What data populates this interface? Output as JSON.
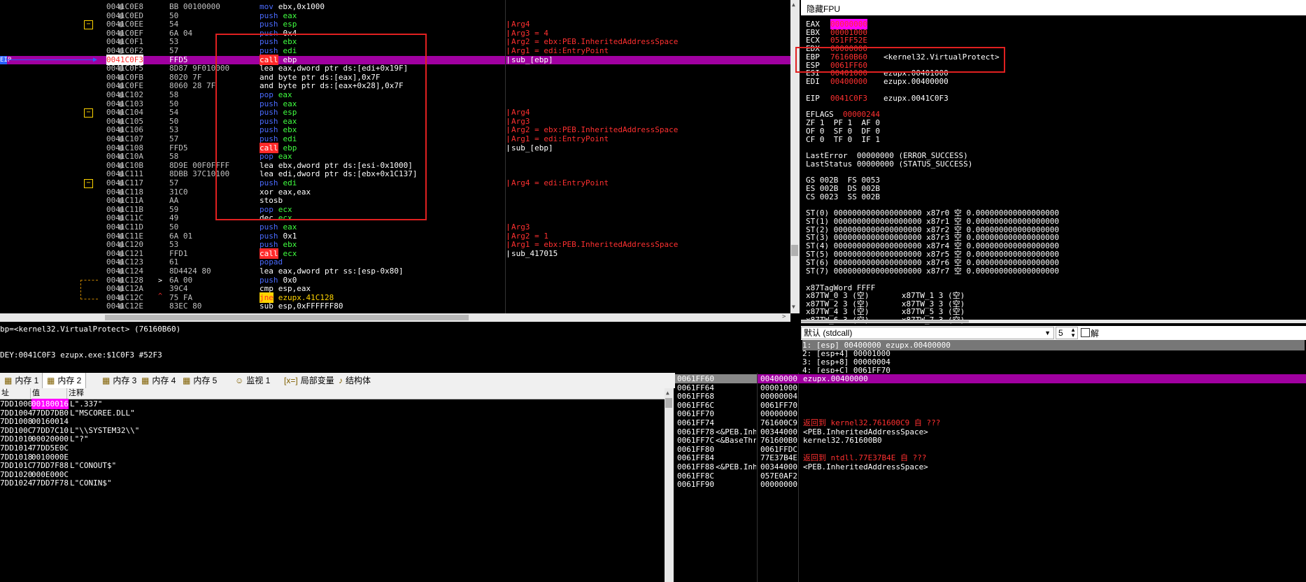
{
  "disasm": {
    "rows": [
      {
        "addr": "0041C0E8",
        "bytes": "BB 00100000",
        "mn": "mov",
        "ops": "ebx,0x1000",
        "cmt": ""
      },
      {
        "addr": "0041C0ED",
        "bytes": "50",
        "mn": "push",
        "ops": "eax",
        "cmt": ""
      },
      {
        "addr": "0041C0EE",
        "bytes": "54",
        "mn": "push",
        "ops": "esp",
        "cmt": "Arg4"
      },
      {
        "addr": "0041C0EF",
        "bytes": "6A 04",
        "mn": "push",
        "ops": "0x4",
        "cmt": "Arg3 = 4"
      },
      {
        "addr": "0041C0F1",
        "bytes": "53",
        "mn": "push",
        "ops": "ebx",
        "cmt": "Arg2 = ebx:PEB.InheritedAddressSpace"
      },
      {
        "addr": "0041C0F2",
        "bytes": "57",
        "mn": "push",
        "ops": "edi",
        "cmt": "Arg1 = edi:EntryPoint"
      },
      {
        "addr": "0041C0F3",
        "bytes": "FFD5",
        "mn": "call",
        "ops": "ebp",
        "cmt": "sub_[ebp]"
      },
      {
        "addr": "0041C0F5",
        "bytes": "8D87 9F010000",
        "mn": "lea",
        "ops": "eax,dword ptr ds:[edi+0x19F]",
        "cmt": ""
      },
      {
        "addr": "0041C0FB",
        "bytes": "8020 7F",
        "mn": "and",
        "ops": "byte ptr ds:[eax],0x7F",
        "cmt": ""
      },
      {
        "addr": "0041C0FE",
        "bytes": "8060 28 7F",
        "mn": "and",
        "ops": "byte ptr ds:[eax+0x28],0x7F",
        "cmt": ""
      },
      {
        "addr": "0041C102",
        "bytes": "58",
        "mn": "pop",
        "ops": "eax",
        "cmt": ""
      },
      {
        "addr": "0041C103",
        "bytes": "50",
        "mn": "push",
        "ops": "eax",
        "cmt": ""
      },
      {
        "addr": "0041C104",
        "bytes": "54",
        "mn": "push",
        "ops": "esp",
        "cmt": "Arg4"
      },
      {
        "addr": "0041C105",
        "bytes": "50",
        "mn": "push",
        "ops": "eax",
        "cmt": "Arg3"
      },
      {
        "addr": "0041C106",
        "bytes": "53",
        "mn": "push",
        "ops": "ebx",
        "cmt": "Arg2 = ebx:PEB.InheritedAddressSpace"
      },
      {
        "addr": "0041C107",
        "bytes": "57",
        "mn": "push",
        "ops": "edi",
        "cmt": "Arg1 = edi:EntryPoint"
      },
      {
        "addr": "0041C108",
        "bytes": "FFD5",
        "mn": "call",
        "ops": "ebp",
        "cmt": "sub_[ebp]"
      },
      {
        "addr": "0041C10A",
        "bytes": "58",
        "mn": "pop",
        "ops": "eax",
        "cmt": ""
      },
      {
        "addr": "0041C10B",
        "bytes": "8D9E 00F0FFFF",
        "mn": "lea",
        "ops": "ebx,dword ptr ds:[esi-0x1000]",
        "cmt": ""
      },
      {
        "addr": "0041C111",
        "bytes": "8DBB 37C10100",
        "mn": "lea",
        "ops": "edi,dword ptr ds:[ebx+0x1C137]",
        "cmt": ""
      },
      {
        "addr": "0041C117",
        "bytes": "57",
        "mn": "push",
        "ops": "edi",
        "cmt": "Arg4 = edi:EntryPoint"
      },
      {
        "addr": "0041C118",
        "bytes": "31C0",
        "mn": "xor",
        "ops": "eax,eax",
        "cmt": ""
      },
      {
        "addr": "0041C11A",
        "bytes": "AA",
        "mn": "stosb",
        "ops": "",
        "cmt": ""
      },
      {
        "addr": "0041C11B",
        "bytes": "59",
        "mn": "pop",
        "ops": "ecx",
        "cmt": ""
      },
      {
        "addr": "0041C11C",
        "bytes": "49",
        "mn": "dec",
        "ops": "ecx",
        "cmt": ""
      },
      {
        "addr": "0041C11D",
        "bytes": "50",
        "mn": "push",
        "ops": "eax",
        "cmt": "Arg3"
      },
      {
        "addr": "0041C11E",
        "bytes": "6A 01",
        "mn": "push",
        "ops": "0x1",
        "cmt": "Arg2 = 1"
      },
      {
        "addr": "0041C120",
        "bytes": "53",
        "mn": "push",
        "ops": "ebx",
        "cmt": "Arg1 = ebx:PEB.InheritedAddressSpace"
      },
      {
        "addr": "0041C121",
        "bytes": "FFD1",
        "mn": "call",
        "ops": "ecx",
        "cmt": "sub_417015"
      },
      {
        "addr": "0041C123",
        "bytes": "61",
        "mn": "popad",
        "ops": "",
        "cmt": ""
      },
      {
        "addr": "0041C124",
        "bytes": "8D4424 80",
        "mn": "lea",
        "ops": "eax,dword ptr ss:[esp-0x80]",
        "cmt": ""
      },
      {
        "addr": "0041C128",
        "bytes": "6A 00",
        "mn": "push",
        "ops": "0x0",
        "cmt": ""
      },
      {
        "addr": "0041C12A",
        "bytes": "39C4",
        "mn": "cmp",
        "ops": "esp,eax",
        "cmt": ""
      },
      {
        "addr": "0041C12C",
        "bytes": "75 FA",
        "mn": "jne",
        "ops": "ezupx.41C128",
        "cmt": ""
      },
      {
        "addr": "0041C12E",
        "bytes": "83EC 80",
        "mn": "sub",
        "ops": "esp,0xFFFFFF80",
        "cmt": ""
      }
    ],
    "eip_label": "EIP"
  },
  "registers": {
    "header": "隐藏FPU",
    "gp": [
      {
        "name": "EAX",
        "val": "00000000",
        "info": ""
      },
      {
        "name": "EBX",
        "val": "00001000",
        "info": ""
      },
      {
        "name": "ECX",
        "val": "051FF52E",
        "info": ""
      },
      {
        "name": "EDX",
        "val": "00000000",
        "info": ""
      },
      {
        "name": "EBP",
        "val": "76160B60",
        "info": "<kernel32.VirtualProtect>"
      },
      {
        "name": "ESP",
        "val": "0061FF60",
        "info": ""
      },
      {
        "name": "ESI",
        "val": "00401000",
        "info": "ezupx.00401000"
      },
      {
        "name": "EDI",
        "val": "00400000",
        "info": "ezupx.00400000"
      }
    ],
    "eip": {
      "name": "EIP",
      "val": "0041C0F3",
      "info": "ezupx.0041C0F3"
    },
    "eflags": {
      "name": "EFLAGS",
      "val": "00000244"
    },
    "flags": [
      "ZF 1  PF 1  AF 0",
      "OF 0  SF 0  DF 0",
      "CF 0  TF 0  IF 1"
    ],
    "last": [
      "LastError  00000000 (ERROR_SUCCESS)",
      "LastStatus 00000000 (STATUS_SUCCESS)"
    ],
    "segs": [
      "GS 002B  FS 0053",
      "ES 002B  DS 002B",
      "CS 0023  SS 002B"
    ],
    "st": [
      "ST(0) 0000000000000000000 x87r0 空 0.000000000000000000",
      "ST(1) 0000000000000000000 x87r1 空 0.000000000000000000",
      "ST(2) 0000000000000000000 x87r2 空 0.000000000000000000",
      "ST(3) 0000000000000000000 x87r3 空 0.000000000000000000",
      "ST(4) 0000000000000000000 x87r4 空 0.000000000000000000",
      "ST(5) 0000000000000000000 x87r5 空 0.000000000000000000",
      "ST(6) 0000000000000000000 x87r6 空 0.000000000000000000",
      "ST(7) 0000000000000000000 x87r7 空 0.000000000000000000"
    ],
    "tagword": "x87TagWord FFFF",
    "tw": [
      "x87TW_0 3 (空)       x87TW_1 3 (空)",
      "x87TW_2 3 (空)       x87TW_3 3 (空)",
      "x87TW_4 3 (空)       x87TW_5 3 (空)",
      "x87TW_6 3 (空)       x87TW_7 3 (空)"
    ]
  },
  "callconv": {
    "select": "默认 (stdcall)",
    "count": "5",
    "check_label": "解",
    "args": [
      "1: [esp] 00400000 ezupx.00400000",
      "2: [esp+4] 00001000",
      "3: [esp+8] 00000004",
      "4: [esp+C] 0061FF70"
    ]
  },
  "info": {
    "line1": "bp=<kernel32.VirtualProtect> (76160B60)",
    "line2": "DEY:0041C0F3 ezupx.exe:$1C0F3 #52F3"
  },
  "dump_tabs": [
    {
      "icon": "▦",
      "label": "内存 1"
    },
    {
      "icon": "▦",
      "label": "内存 2"
    },
    {
      "icon": "▦",
      "label": "内存 3"
    },
    {
      "icon": "▦",
      "label": "内存 4"
    },
    {
      "icon": "▦",
      "label": "内存 5"
    },
    {
      "icon": "☺",
      "label": "监视 1"
    },
    {
      "icon": "[x=]",
      "label": "局部变量"
    },
    {
      "icon": "♪",
      "label": "结构体"
    }
  ],
  "dump": {
    "headers": [
      "址",
      "值",
      "注释"
    ],
    "rows": [
      {
        "addr": "7DD1000",
        "val": "00180016",
        "cmt": "L\".337\""
      },
      {
        "addr": "7DD1004",
        "val": "77DD7DB0",
        "cmt": "L\"MSCOREE.DLL\""
      },
      {
        "addr": "7DD1008",
        "val": "00160014",
        "cmt": ""
      },
      {
        "addr": "7DD100C",
        "val": "77DD7C10",
        "cmt": "L\"\\\\SYSTEM32\\\\\""
      },
      {
        "addr": "7DD1010",
        "val": "00020000",
        "cmt": "L\"?\""
      },
      {
        "addr": "7DD1014",
        "val": "77DD5E0C",
        "cmt": ""
      },
      {
        "addr": "7DD1018",
        "val": "0010000E",
        "cmt": ""
      },
      {
        "addr": "7DD101C",
        "val": "77DD7F88",
        "cmt": "L\"CONOUT$\""
      },
      {
        "addr": "7DD1020",
        "val": "000E000C",
        "cmt": ""
      },
      {
        "addr": "7DD1024",
        "val": "77DD7F78",
        "cmt": "L\"CONIN$\""
      }
    ]
  },
  "stack": {
    "rows": [
      {
        "addr": "0061FF60",
        "note": "",
        "val": "00400000",
        "cmt": "ezupx.00400000",
        "cls": "white"
      },
      {
        "addr": "0061FF64",
        "note": "",
        "val": "00001000",
        "cmt": "",
        "cls": "white"
      },
      {
        "addr": "0061FF68",
        "note": "",
        "val": "00000004",
        "cmt": "",
        "cls": "white"
      },
      {
        "addr": "0061FF6C",
        "note": "",
        "val": "0061FF70",
        "cmt": "",
        "cls": "white"
      },
      {
        "addr": "0061FF70",
        "note": "",
        "val": "00000000",
        "cmt": "",
        "cls": "white"
      },
      {
        "addr": "0061FF74",
        "note": "",
        "val": "761600C9",
        "cmt": "返回到 kernel32.761600C9 自 ???",
        "cls": "red"
      },
      {
        "addr": "0061FF78",
        "note": "<&PEB.Inhe",
        "val": "00344000",
        "cmt": "<PEB.InheritedAddressSpace>",
        "cls": "white"
      },
      {
        "addr": "0061FF7C",
        "note": "<&BaseThre",
        "val": "761600B0",
        "cmt": "kernel32.761600B0",
        "cls": "white"
      },
      {
        "addr": "0061FF80",
        "note": "",
        "val": "0061FFDC",
        "cmt": "",
        "cls": "white"
      },
      {
        "addr": "0061FF84",
        "note": "",
        "val": "77E37B4E",
        "cmt": "返回到 ntdll.77E37B4E 自 ???",
        "cls": "red"
      },
      {
        "addr": "0061FF88",
        "note": "<&PEB.Inhe",
        "val": "00344000",
        "cmt": "<PEB.InheritedAddressSpace>",
        "cls": "white"
      },
      {
        "addr": "0061FF8C",
        "note": "",
        "val": "057E0AF2",
        "cmt": "",
        "cls": "white"
      },
      {
        "addr": "0061FF90",
        "note": "",
        "val": "00000000",
        "cmt": "",
        "cls": "white"
      }
    ]
  },
  "colors": {
    "accent": "#a000a0",
    "red": "#ff3030",
    "mnemonic": "#4a6bff",
    "ops": "#40ff40",
    "annot": "#e02020"
  }
}
